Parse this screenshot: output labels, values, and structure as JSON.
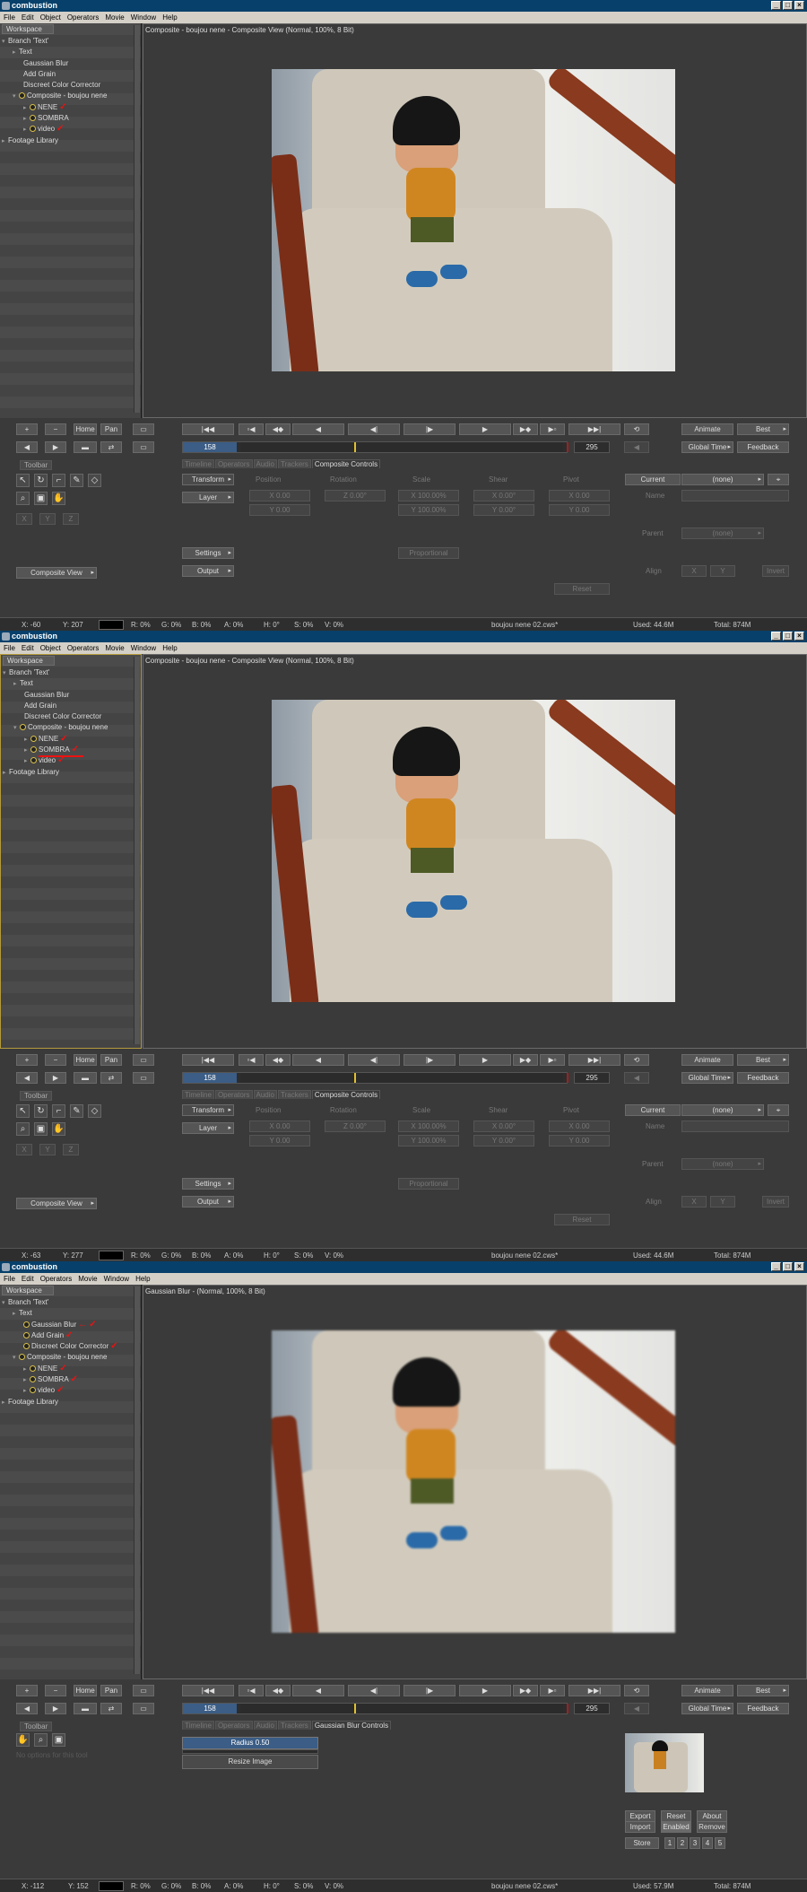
{
  "app": {
    "title": "combustion",
    "menu": [
      "File",
      "Edit",
      "Object",
      "Operators",
      "Movie",
      "Window",
      "Help"
    ],
    "menu_short": [
      "File",
      "Edit",
      "Operators",
      "Movie",
      "Window",
      "Help"
    ],
    "win_min": "_",
    "win_max": "□",
    "win_close": "×"
  },
  "workspace": {
    "tab": "Workspace",
    "branch": "Branch 'Text'",
    "text": "Text",
    "gaussian": "Gaussian Blur",
    "grain": "Add Grain",
    "dcc": "Discreet Color Corrector",
    "composite": "Composite - boujou nene",
    "nene": "NENE",
    "sombra": "SOMBRA",
    "video": "video",
    "footage": "Footage Library"
  },
  "viewer": {
    "title1": "Composite - boujou nene - Composite View (Normal, 100%, 8 Bit)",
    "title3": "Gaussian Blur -  (Normal, 100%, 8 Bit)"
  },
  "transport": {
    "plus": "+",
    "minus": "−",
    "home": "Home",
    "pan": "Pan",
    "first": "|◀◀",
    "prev_key": "▫◀",
    "play_back_kf": "◀◆",
    "step_back": "◀",
    "back1": "◀|",
    "fwd1": "|▶",
    "play": "▶",
    "play_kf": "▶◆",
    "next_key": "▶▫",
    "last": "▶▶|",
    "loop": "⟲",
    "back_arrow": "◀",
    "fwd_arrow": "▶",
    "frame": "158",
    "frame_end": "295",
    "animate": "Animate",
    "best": "Best",
    "global_time": "Global Time",
    "feedback": "Feedback"
  },
  "controls": {
    "toolbar": "Toolbar",
    "tabs": [
      "Timeline",
      "Operators",
      "Audio",
      "Trackers"
    ],
    "tab_composite": "Composite Controls",
    "tab_gaussian": "Gaussian Blur Controls",
    "transform": "Transform",
    "layer": "Layer",
    "settings": "Settings",
    "output": "Output",
    "composite_view": "Composite View",
    "position": "Position",
    "rotation": "Rotation",
    "scale": "Scale",
    "shear": "Shear",
    "pivot": "Pivot",
    "x0": "X 0.00",
    "y0": "Y 0.00",
    "rot": "Z 0.00°",
    "sx": "X 100.00%",
    "sy": "Y 100.00%",
    "shx": "X 0.00°",
    "shy": "Y 0.00°",
    "proportional": "Proportional",
    "reset": "Reset",
    "current": "Current",
    "none": "(none)",
    "name": "Name",
    "parent": "Parent",
    "align": "Align",
    "invert": "Invert",
    "x": "X",
    "y": "Y",
    "z": "Z",
    "btn_b": "B",
    "radius": "Radius 0.50",
    "resize": "Resize Image",
    "no_options": "No options for this tool",
    "export": "Export",
    "reset2": "Reset",
    "about": "About",
    "import": "Import",
    "enabled": "Enabled",
    "remove": "Remove",
    "store": "Store",
    "slots": [
      "1",
      "2",
      "3",
      "4",
      "5"
    ]
  },
  "tool_icons": [
    "arrow-icon",
    "rotate-icon",
    "crop-icon",
    "pen-icon",
    "mask-icon",
    "paint-icon",
    "zoom-icon",
    "box-icon",
    "hand-icon"
  ],
  "status": [
    {
      "x": "X:  -60",
      "y": "Y:  207",
      "r": "R: 0%",
      "g": "G: 0%",
      "b": "B: 0%",
      "a": "A: 0%",
      "h": "H: 0°",
      "s": "S: 0%",
      "v": "V: 0%",
      "file": "boujou nene 02.cws*",
      "used": "Used: 44.6M",
      "total": "Total: 874M"
    },
    {
      "x": "X:  -63",
      "y": "Y:  277",
      "r": "R: 0%",
      "g": "G: 0%",
      "b": "B: 0%",
      "a": "A: 0%",
      "h": "H: 0°",
      "s": "S: 0%",
      "v": "V: 0%",
      "file": "boujou nene 02.cws*",
      "used": "Used: 44.6M",
      "total": "Total: 874M"
    },
    {
      "x": "X:  -112",
      "y": "Y:  152",
      "r": "R: 0%",
      "g": "G: 0%",
      "b": "B: 0%",
      "a": "A: 0%",
      "h": "H: 0°",
      "s": "S: 0%",
      "v": "V: 0%",
      "file": "boujou nene 02.cws*",
      "used": "Used: 57.9M",
      "total": "Total: 874M"
    }
  ],
  "marks": {
    "check": "✓",
    "arrow": "←"
  }
}
